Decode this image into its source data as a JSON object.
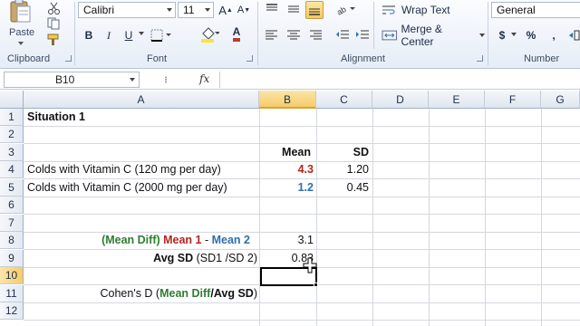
{
  "ribbon": {
    "clipboard": {
      "paste_label": "Paste",
      "group_label": "Clipboard"
    },
    "font": {
      "font_name": "Calibri",
      "font_size": "11",
      "grow_label": "A",
      "shrink_label": "A",
      "bold_label": "B",
      "italic_label": "I",
      "underline_label": "U",
      "font_color_label": "A",
      "group_label": "Font",
      "fill_color": "#f5e642",
      "text_color": "#c0392b"
    },
    "alignment": {
      "wrap_text_label": "Wrap Text",
      "merge_center_label": "Merge & Center",
      "group_label": "Alignment"
    },
    "number": {
      "format": "General",
      "currency_label": "$",
      "percent_label": "%",
      "comma_label": ",",
      "group_label": "Number"
    }
  },
  "formula_bar": {
    "name_box": "B10",
    "fx_label": "fx",
    "content": ""
  },
  "sheet": {
    "columns": [
      "A",
      "B",
      "C",
      "D",
      "E",
      "F",
      "G"
    ],
    "rows": [
      "1",
      "2",
      "3",
      "4",
      "5",
      "6",
      "7",
      "8",
      "9",
      "10",
      "11",
      "12"
    ],
    "active_column": "B",
    "active_row": "10",
    "cells": {
      "A1": "Situation 1",
      "B3": "Mean",
      "C3": "SD",
      "A4": "Colds  with Vitamin C (120 mg per day)",
      "B4": "4.3",
      "C4": "1.20",
      "A5": "Colds  with Vitamin C (2000 mg per day)",
      "B5": "1.2",
      "C5": "0.45",
      "A8": {
        "p1": "(Mean Diff)",
        "p2": " Mean 1",
        "p3": " - ",
        "p4": "Mean 2"
      },
      "B8": "3.1",
      "A9": {
        "p1": "Avg SD",
        "p2": " (SD1 /SD 2)"
      },
      "B9": "0.83",
      "A11": {
        "p1": "Cohen's D (",
        "p2": "Mean Diff",
        "p3": "/",
        "p4": "Avg SD",
        "p5": ")"
      }
    }
  },
  "colors": {
    "accent_selected": "#f5cc6a",
    "mean1_red": "#b3261e",
    "mean2_blue": "#2e6fa8",
    "diff_green": "#2e7d32"
  }
}
